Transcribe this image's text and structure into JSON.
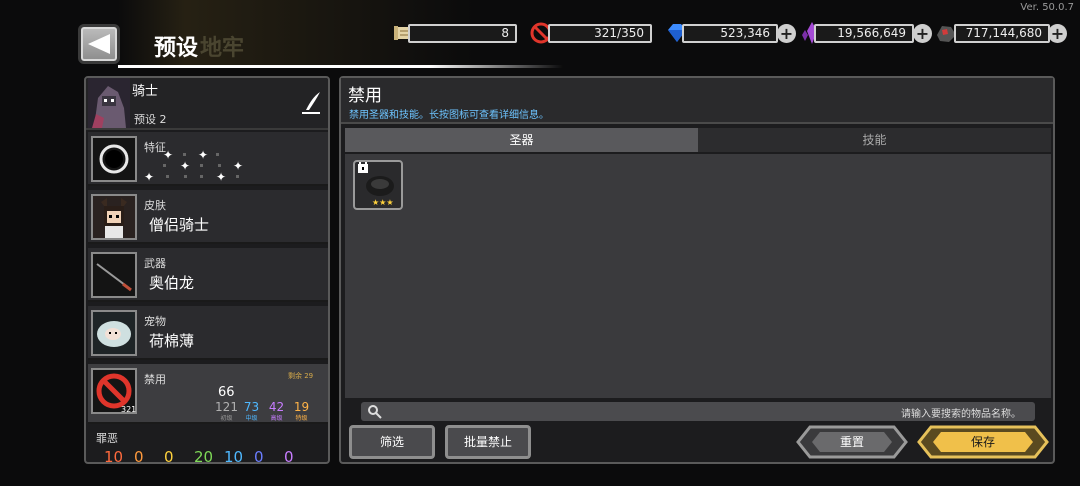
{
  "version": "Ver. 50.0.7",
  "header": {
    "title": "预设",
    "title_ghost": "地牢"
  },
  "currencies": [
    {
      "name": "scroll",
      "value": "8"
    },
    {
      "name": "ban",
      "value": "321/350"
    },
    {
      "name": "gem",
      "value": "523,346"
    },
    {
      "name": "crystal",
      "value": "19,566,649"
    },
    {
      "name": "ore",
      "value": "717,144,680"
    }
  ],
  "hero": {
    "name": "骑士",
    "preset": "预设 2"
  },
  "rows": {
    "trait": {
      "label": "特征"
    },
    "skin": {
      "label": "皮肤",
      "value": "僧侣骑士"
    },
    "weapon": {
      "label": "武器",
      "value": "奥伯龙"
    },
    "pet": {
      "label": "宠物",
      "value": "荷棉薄"
    },
    "ban": {
      "label": "禁用",
      "count": "321",
      "remain": "剩余 29",
      "total": "66",
      "nums": [
        "121",
        "73",
        "42",
        "19"
      ],
      "levels": [
        "初级",
        "中级",
        "高级",
        "特级"
      ],
      "colors": [
        "#b0b0b0",
        "#4fb8ff",
        "#c77dff",
        "#ffb347"
      ]
    },
    "sin": {
      "label": "罪恶",
      "nums": [
        "10",
        "0",
        "0",
        "20",
        "10",
        "0",
        "0"
      ]
    }
  },
  "panel": {
    "title": "禁用",
    "subtitle": "禁用圣器和技能。长按图标可查看详细信息。",
    "tabs": [
      "圣器",
      "技能"
    ],
    "search_placeholder": "请输入要搜索的物品名称。",
    "buttons": {
      "filter": "筛选",
      "batch": "批量禁止",
      "reset": "重置",
      "save": "保存"
    }
  }
}
